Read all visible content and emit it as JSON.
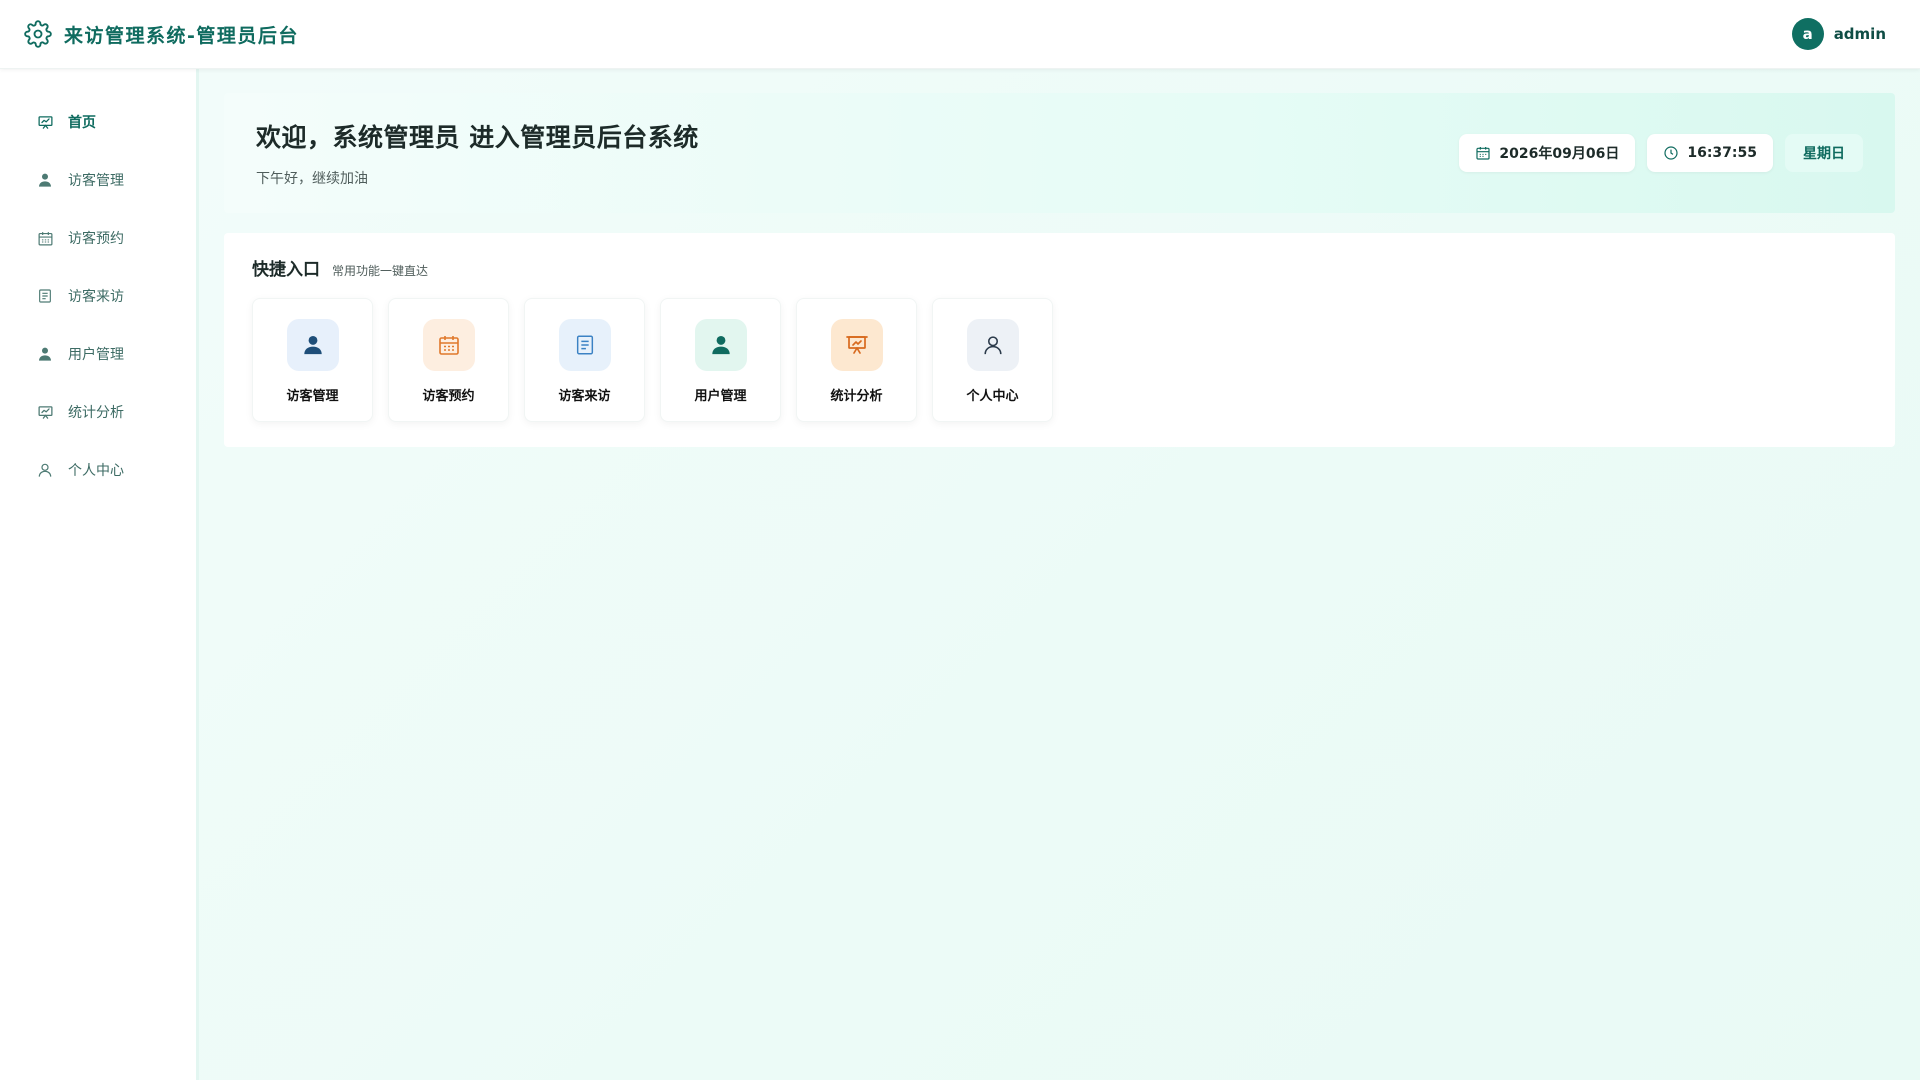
{
  "header": {
    "title": "来访管理系统-管理员后台",
    "avatar_letter": "a",
    "username": "admin"
  },
  "sidebar": {
    "items": [
      {
        "label": "首页",
        "icon": "presentation-icon",
        "active": true
      },
      {
        "label": "访客管理",
        "icon": "user-icon"
      },
      {
        "label": "访客预约",
        "icon": "calendar-icon"
      },
      {
        "label": "访客来访",
        "icon": "document-icon"
      },
      {
        "label": "用户管理",
        "icon": "user-icon"
      },
      {
        "label": "统计分析",
        "icon": "presentation-icon"
      },
      {
        "label": "个人中心",
        "icon": "user-outline-icon"
      }
    ]
  },
  "welcome": {
    "title": "欢迎，系统管理员 进入管理员后台系统",
    "subtitle": "下午好，继续加油",
    "date": "2026年09月06日",
    "time": "16:37:55",
    "weekday": "星期日"
  },
  "quick": {
    "title": "快捷入口",
    "subtitle": "常用功能一键直达",
    "items": [
      {
        "label": "访客管理",
        "icon": "user-icon",
        "bg": "#e7f0fb",
        "fg": "#1e4e79"
      },
      {
        "label": "访客预约",
        "icon": "calendar-icon",
        "bg": "#fdeee0",
        "fg": "#e0782b"
      },
      {
        "label": "访客来访",
        "icon": "document-icon",
        "bg": "#e7f1fb",
        "fg": "#3b82c4"
      },
      {
        "label": "用户管理",
        "icon": "user-icon",
        "bg": "#e2f6ef",
        "fg": "#0f6b5f"
      },
      {
        "label": "统计分析",
        "icon": "presentation-icon",
        "bg": "#fde8d0",
        "fg": "#d86a1e"
      },
      {
        "label": "个人中心",
        "icon": "user-outline-icon",
        "bg": "#edf1f6",
        "fg": "#2b3a4a"
      }
    ]
  },
  "colors": {
    "brand": "#0f6b5f",
    "accent_bg": "#e4fbf5"
  }
}
